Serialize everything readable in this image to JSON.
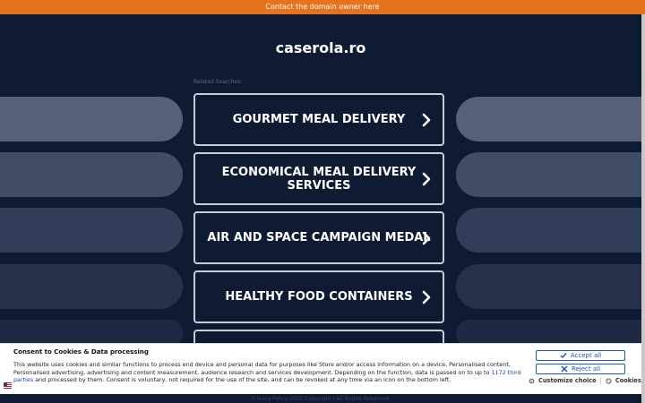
{
  "topbar": {
    "label": "Contact the domain owner here"
  },
  "site": {
    "domain": "caserola.ro",
    "related_label": "Related Searches:"
  },
  "links": [
    {
      "label": "GOURMET MEAL DELIVERY"
    },
    {
      "label": "ECONOMICAL MEAL DELIVERY SERVICES"
    },
    {
      "label": "AIR AND SPACE CAMPAIGN MEDAL"
    },
    {
      "label": "HEALTHY FOOD CONTAINERS"
    },
    {
      "label": ""
    }
  ],
  "footer": {
    "text": "Privacy Policy   2025 Copyright | All Rights Reserved."
  },
  "consent": {
    "title": "Consent to Cookies & Data processing",
    "text_part1": "This website uses cookies and similar functions to process end device and personal data for purposes like Store and/or access information on a device, Personalised content, Personalised advertising, advertising and content measurement, audience research and services development. Depending on the function, data is passed on to up to ",
    "third_parties_link": "1172 third parties",
    "text_part2": " and processed by them. Consent is voluntary, not required for the use of the site, and can be revoked at any time via an icon on the bottom left.",
    "accept_label": "Accept all",
    "reject_label": "Reject all",
    "customize_label": "Customize choice",
    "separator": "|",
    "cookies_label": "Cookies"
  },
  "colors": {
    "topbar": "#e8731f",
    "background": "#0f1b33",
    "accent": "#1e55c0"
  }
}
